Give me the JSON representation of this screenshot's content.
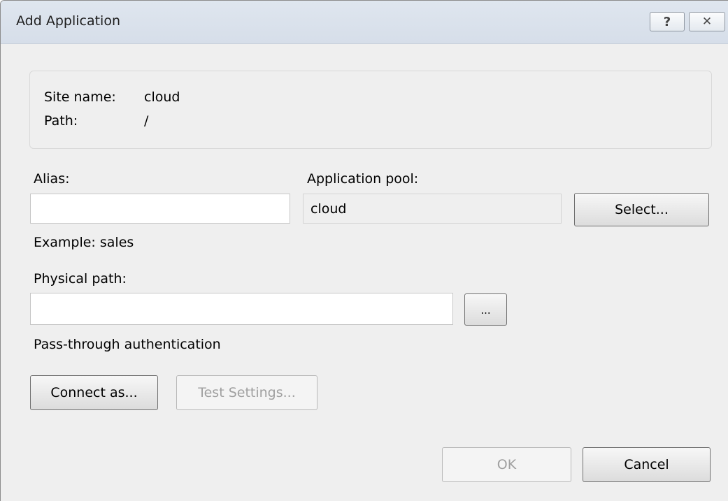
{
  "window": {
    "title": "Add Application",
    "help_glyph": "?",
    "close_glyph": "✕"
  },
  "info": {
    "site_name_label": "Site name:",
    "site_name_value": "cloud",
    "path_label": "Path:",
    "path_value": "/"
  },
  "form": {
    "alias_label": "Alias:",
    "alias_value": "",
    "alias_example": "Example: sales",
    "app_pool_label": "Application pool:",
    "app_pool_value": "cloud",
    "select_button": "Select...",
    "physical_path_label": "Physical path:",
    "physical_path_value": "",
    "browse_button": "...",
    "pass_through_label": "Pass-through authentication",
    "connect_as_button": "Connect as...",
    "test_settings_button": "Test Settings..."
  },
  "footer": {
    "ok_button": "OK",
    "cancel_button": "Cancel"
  }
}
